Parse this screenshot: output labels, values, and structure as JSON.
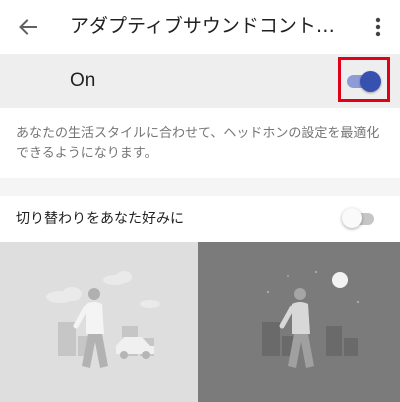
{
  "app_bar": {
    "title": "アダプティブサウンドコント…",
    "back_icon": "arrow-back-icon",
    "more_icon": "more-vert-icon"
  },
  "master_switch": {
    "label": "On",
    "state": "on",
    "accent_color": "#3651b0",
    "highlight_color": "#e0001a"
  },
  "description": "あなたの生活スタイルに合わせて、ヘッドホンの設定を最適化できるようになります。",
  "preference": {
    "label": "切り替わりをあなた好みに",
    "state": "off"
  },
  "illustrations": {
    "day": "walking-person-day-illustration",
    "night": "walking-person-night-illustration"
  }
}
